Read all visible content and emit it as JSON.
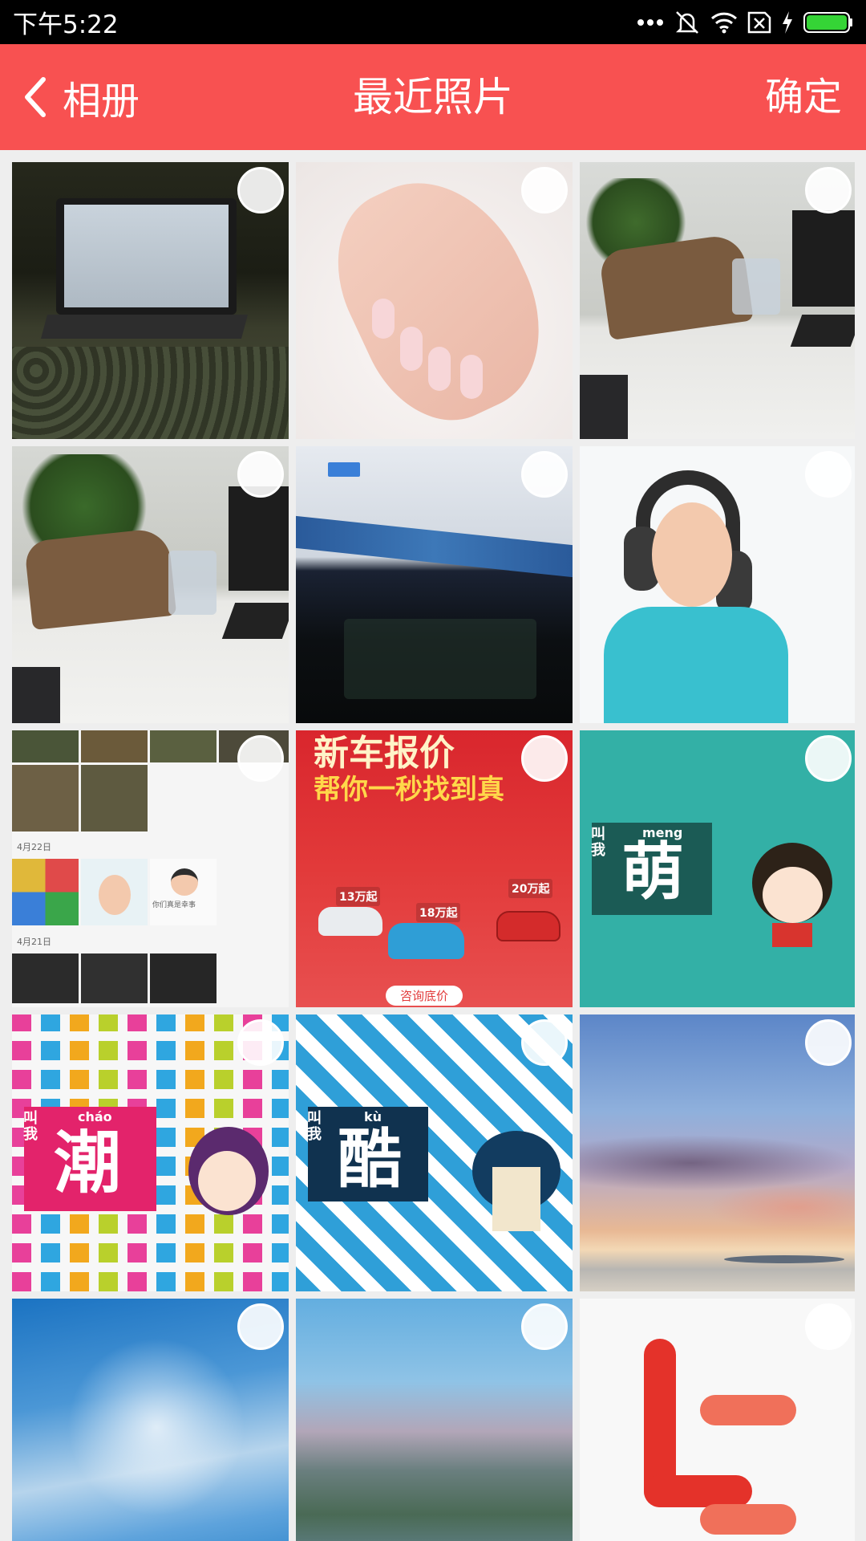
{
  "status": {
    "time": "下午5:22"
  },
  "app_bar": {
    "back_label": "相册",
    "title": "最近照片",
    "confirm_label": "确定"
  },
  "photos": [
    {
      "name": "laptop-photo",
      "description": "Laptop on desk in dark room"
    },
    {
      "name": "nails-photo",
      "description": "Manicured hand on fur"
    },
    {
      "name": "desk-bag-photo-1",
      "description": "Bag on office desk"
    },
    {
      "name": "desk-bag-photo-2",
      "description": "Bag on office desk"
    },
    {
      "name": "monitor-photo",
      "description": "Computer monitor taskbar"
    },
    {
      "name": "baby-headphones-photo",
      "description": "Baby with headphones"
    },
    {
      "name": "album-screenshot-photo",
      "description": "Screenshot of photo album",
      "dates": [
        "4月22日",
        "4月21日"
      ],
      "sticker_text": "你们真是幸事"
    },
    {
      "name": "car-ad-photo",
      "description": "Car ad",
      "headline": "新车报价",
      "subline": "帮你一秒找到真",
      "prices": [
        "13万起",
        "18万起",
        "20万起"
      ],
      "button": "咨询底价"
    },
    {
      "name": "meng-cartoon-photo",
      "description": "Cartoon 萌",
      "jiao_wo": "叫我",
      "pinyin": "meng",
      "hanzi": "萌"
    },
    {
      "name": "chao-cartoon-photo",
      "description": "Cartoon 潮",
      "jiao_wo": "叫我",
      "pinyin": "cháo",
      "hanzi": "潮"
    },
    {
      "name": "ku-cartoon-photo",
      "description": "Cartoon 酷",
      "jiao_wo": "叫我",
      "pinyin": "kù",
      "hanzi": "酷"
    },
    {
      "name": "sunset-sky-photo",
      "description": "Sunset sky over sea"
    },
    {
      "name": "cloudy-sky-photo",
      "description": "Blue sky with clouds"
    },
    {
      "name": "blurred-landscape-photo",
      "description": "Blurry landscape"
    },
    {
      "name": "letv-logo-photo",
      "description": "LeTV logo"
    }
  ]
}
